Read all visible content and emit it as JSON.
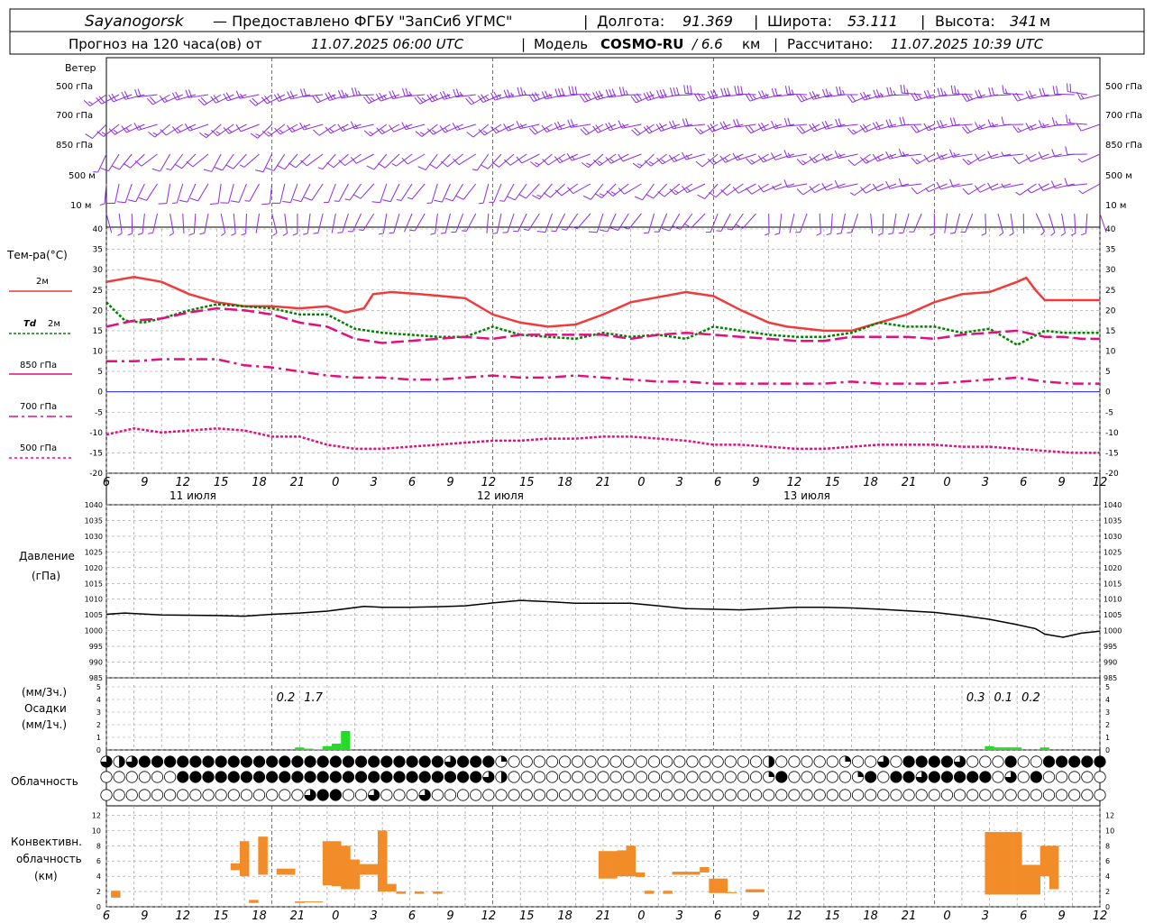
{
  "header": {
    "station": "Sayanogorsk",
    "provider": "— Предоставлено ФГБУ \"ЗапСиб УГМС\"",
    "lon_label": "Долгота:",
    "lon_value": "91.369",
    "lat_label": "Широта:",
    "lat_value": "53.111",
    "alt_label": "Высота:",
    "alt_value": "341",
    "alt_unit": "м",
    "forecast_prefix": "Прогноз на 120 часа(ов) от",
    "forecast_time": "11.07.2025 06:00 UTC",
    "model_label": "Модель",
    "model_name": "COSMO-RU",
    "model_res": "/ 6.6",
    "model_res_unit": "км",
    "calc_label": "Рассчитано:",
    "calc_time": "11.07.2025 10:39 UTC"
  },
  "colors": {
    "wind": "#8B2BE2",
    "t2m": "#EF3B3B",
    "td2m": "#008000",
    "t850": "#E0107F",
    "t700": "#E0107F",
    "t500": "#E0107F",
    "zero_line": "#0000FF",
    "precip": "#22DD22",
    "conv_cloud": "#F28C28",
    "pressure": "#000000",
    "grid": "#9A9A9A"
  },
  "time_axis": {
    "hour_labels": [
      "6",
      "9",
      "12",
      "15",
      "18",
      "21",
      "0",
      "3",
      "6",
      "9",
      "12",
      "15",
      "18",
      "21",
      "0",
      "3",
      "6",
      "9",
      "12",
      "15",
      "18",
      "21",
      "0",
      "3",
      "6",
      "9",
      "12"
    ],
    "day_labels": [
      "11 июля",
      "12 июля",
      "13 июля"
    ]
  },
  "wind_panel": {
    "title": "Ветер",
    "levels": [
      "500 гПа",
      "700 гПа",
      "850 гПа",
      "500 м",
      "10 м"
    ]
  },
  "temp_panel": {
    "title": "Тем-ра(°C)",
    "ticks": [
      "40",
      "35",
      "30",
      "25",
      "20",
      "15",
      "10",
      "5",
      "0",
      "-5",
      "-10",
      "-15",
      "-20"
    ],
    "legend": {
      "t2m": "2м",
      "td_prefix": "Td",
      "td_level": "2м",
      "t850": "850 гПа",
      "t700": "700 гПа",
      "t500": "500 гПа"
    }
  },
  "pressure_panel": {
    "title": "Давление",
    "unit": "(гПа)",
    "ticks": [
      "1040",
      "1035",
      "1030",
      "1025",
      "1020",
      "1015",
      "1010",
      "1005",
      "1000",
      "995",
      "990",
      "985"
    ]
  },
  "precip_panel": {
    "unit_3h": "(мм/3ч.)",
    "title": "Осадки",
    "unit_1h": "(мм/1ч.)",
    "ticks": [
      "5",
      "4",
      "3",
      "2",
      "1",
      "0"
    ],
    "totals": [
      {
        "hour": 21,
        "text": "0.2"
      },
      {
        "hour": 24,
        "text": "1.7"
      },
      {
        "hour": 96,
        "text": "0.3"
      },
      {
        "hour": 99,
        "text": "0.1"
      },
      {
        "hour": 102,
        "text": "0.2"
      }
    ]
  },
  "cloud_panel": {
    "title": "Облачность"
  },
  "conv_panel": {
    "title_1": "Конвективн.",
    "title_2": "облачность",
    "unit": "(км)",
    "ticks": [
      "12",
      "10",
      "8",
      "6",
      "4",
      "2",
      "0"
    ]
  },
  "chart_data": [
    {
      "type": "line",
      "title": "Тем-ра(°C)",
      "x_unit": "hours from 11.07.2025 06:00 UTC",
      "ylim": [
        -20,
        40
      ],
      "series": [
        {
          "name": "2м",
          "style": "solid",
          "x": [
            0,
            3,
            6,
            9,
            12,
            15,
            18,
            21,
            24,
            26,
            28,
            29,
            31,
            34,
            39,
            42,
            45,
            48,
            51,
            54,
            57,
            63,
            66,
            69,
            72,
            74,
            78,
            81,
            84,
            87,
            90,
            93,
            96,
            99,
            100,
            101,
            102,
            104,
            105,
            106,
            108
          ],
          "y": [
            27,
            28.2,
            27,
            24,
            22,
            21,
            21,
            20.5,
            21,
            19.5,
            20.5,
            24,
            24.5,
            24,
            23,
            19,
            17,
            16,
            16.5,
            19,
            22,
            24.5,
            23.5,
            20,
            17,
            16,
            15,
            15,
            17,
            19,
            22,
            24,
            24.5,
            27,
            28,
            25,
            22.5,
            22.5,
            22.5,
            22.5,
            22.5
          ]
        },
        {
          "name": "Td 2м",
          "style": "dotted",
          "x": [
            0,
            2,
            4,
            6,
            9,
            12,
            15,
            18,
            21,
            24,
            27,
            30,
            33,
            36,
            39,
            42,
            45,
            48,
            51,
            54,
            57,
            60,
            63,
            66,
            69,
            72,
            75,
            78,
            81,
            84,
            87,
            90,
            93,
            96,
            99,
            102,
            104,
            106,
            108
          ],
          "y": [
            22,
            17.5,
            17,
            18,
            20,
            21.5,
            21,
            20.5,
            19,
            19,
            15.5,
            14.5,
            14,
            13.5,
            13.5,
            16,
            14,
            13.5,
            13,
            14.5,
            13.5,
            14,
            13,
            16,
            15,
            14,
            13.5,
            13.5,
            14.5,
            17,
            16,
            16,
            14.5,
            15.5,
            11.5,
            15,
            14.5,
            14.5,
            14.5
          ]
        },
        {
          "name": "850 гПа",
          "style": "dash",
          "x": [
            0,
            3,
            6,
            9,
            12,
            15,
            18,
            21,
            24,
            27,
            30,
            33,
            36,
            39,
            42,
            45,
            48,
            51,
            54,
            57,
            60,
            63,
            66,
            69,
            72,
            75,
            78,
            81,
            84,
            87,
            90,
            93,
            96,
            99,
            102,
            104,
            106,
            108
          ],
          "y": [
            16,
            17.5,
            18,
            19.5,
            20.5,
            20,
            19,
            17,
            16,
            13,
            12,
            12.5,
            13,
            13.5,
            13,
            14,
            14,
            14,
            14,
            13,
            14,
            14.5,
            14,
            13.5,
            13,
            12.5,
            12.5,
            13.5,
            13.5,
            13.5,
            13,
            14,
            14.5,
            15,
            13.5,
            13.5,
            13,
            13
          ]
        },
        {
          "name": "700 гПа",
          "style": "dashdot",
          "x": [
            0,
            3,
            6,
            9,
            12,
            15,
            18,
            21,
            24,
            27,
            30,
            33,
            36,
            39,
            42,
            45,
            48,
            51,
            54,
            57,
            60,
            63,
            66,
            69,
            72,
            75,
            78,
            81,
            84,
            87,
            90,
            93,
            96,
            99,
            102,
            105,
            108
          ],
          "y": [
            7.5,
            7.5,
            8,
            8,
            8,
            6.5,
            6,
            5,
            4,
            3.5,
            3.5,
            3,
            3,
            3.5,
            4,
            3.5,
            3.5,
            4,
            3.5,
            3,
            2.5,
            2.5,
            2,
            2,
            2,
            2,
            2,
            2.5,
            2,
            2,
            2,
            2.5,
            3,
            3.5,
            2.5,
            2,
            2
          ]
        },
        {
          "name": "500 гПа",
          "style": "dotted",
          "x": [
            0,
            3,
            6,
            9,
            12,
            15,
            18,
            21,
            24,
            27,
            30,
            33,
            36,
            39,
            42,
            45,
            48,
            51,
            54,
            57,
            60,
            63,
            66,
            69,
            72,
            75,
            78,
            81,
            84,
            87,
            90,
            93,
            96,
            99,
            102,
            105,
            108
          ],
          "y": [
            -10.5,
            -9,
            -10,
            -9.5,
            -9,
            -9.5,
            -11,
            -11,
            -13,
            -14,
            -14,
            -13.5,
            -13,
            -12.5,
            -12,
            -12,
            -11.5,
            -11.5,
            -11,
            -11,
            -11.5,
            -12,
            -13,
            -13,
            -13.5,
            -14,
            -14,
            -13.5,
            -13,
            -13,
            -13,
            -13.5,
            -13.5,
            -14,
            -14.5,
            -15,
            -15
          ]
        }
      ]
    },
    {
      "type": "line",
      "title": "Давление",
      "x_unit": "hours from 11.07.2025 06:00 UTC",
      "ylim": [
        985,
        1040
      ],
      "series": [
        {
          "name": "Давление",
          "x": [
            0,
            2,
            6,
            12,
            15,
            18,
            21,
            24,
            28,
            30,
            33,
            36,
            39,
            42,
            45,
            48,
            51,
            54,
            57,
            60,
            63,
            66,
            69,
            72,
            75,
            78,
            81,
            84,
            87,
            90,
            93,
            96,
            99,
            101,
            102,
            104,
            106,
            108
          ],
          "y": [
            1005.2,
            1005.6,
            1005,
            1004.8,
            1004.6,
            1005.2,
            1005.6,
            1006.2,
            1007.7,
            1007.4,
            1007.4,
            1007.6,
            1007.9,
            1008.8,
            1009.6,
            1009.2,
            1008.7,
            1008.7,
            1008.7,
            1007.9,
            1007,
            1006.8,
            1006.6,
            1007,
            1007.4,
            1007.4,
            1007.2,
            1006.8,
            1006.3,
            1005.8,
            1004.8,
            1003.6,
            1001.9,
            1000.6,
            998.9,
            997.9,
            999.2,
            999.8
          ]
        }
      ]
    },
    {
      "type": "bar",
      "title": "Осадки",
      "x_unit": "hours from 11.07.2025 06:00 UTC",
      "ylim": [
        0,
        5
      ],
      "series": [
        {
          "name": "мм/1ч.",
          "x": [
            21,
            22,
            23,
            24,
            25,
            26,
            96,
            97,
            98,
            99,
            102
          ],
          "y": [
            0.2,
            0.1,
            0.05,
            0.3,
            0.5,
            1.5,
            0.3,
            0.2,
            0.2,
            0.2,
            0.2
          ]
        }
      ]
    },
    {
      "type": "bar",
      "title": "Конвективн. облачность",
      "x_unit": "hours from 11.07.2025 06:00 UTC",
      "ylim": [
        0,
        13
      ],
      "series": [
        {
          "name": "(км)",
          "x": [
            1,
            14,
            15,
            16,
            17,
            19,
            20,
            21,
            22,
            23,
            24,
            25,
            26,
            27,
            28,
            29,
            30,
            31,
            32,
            34,
            36,
            54,
            55,
            56,
            57,
            58,
            59,
            61,
            62,
            63,
            64,
            65,
            66,
            67,
            68,
            70,
            71,
            96,
            97,
            98,
            99,
            100,
            101,
            102,
            103
          ],
          "bottom": [
            1.2,
            4.8,
            4,
            0.5,
            4.2,
            4.2,
            4.2,
            0.5,
            0.6,
            0.6,
            2.8,
            2.7,
            2.3,
            2.3,
            4.2,
            4.2,
            2,
            2,
            1.7,
            1.7,
            1.7,
            3.7,
            3.7,
            4,
            4,
            3.9,
            1.7,
            1.7,
            4.2,
            4.2,
            4.2,
            4.5,
            1.8,
            1.8,
            1.8,
            1.9,
            1.9,
            1.6,
            1.6,
            1.6,
            1.6,
            1.6,
            1.6,
            4,
            2.3
          ],
          "top": [
            2.1,
            5.7,
            8.6,
            0.9,
            9.2,
            5,
            5,
            0.7,
            0.7,
            0.7,
            8.6,
            8.6,
            8,
            6.2,
            5.6,
            5.6,
            10,
            3,
            2,
            2,
            2,
            7.3,
            7.3,
            7.4,
            8,
            4.5,
            2.1,
            2.1,
            4.6,
            4.6,
            4.6,
            5.2,
            3.7,
            3.7,
            1.9,
            2.3,
            2.3,
            9.8,
            9.8,
            9.8,
            9.8,
            5.5,
            5.5,
            8,
            8
          ]
        }
      ]
    }
  ]
}
